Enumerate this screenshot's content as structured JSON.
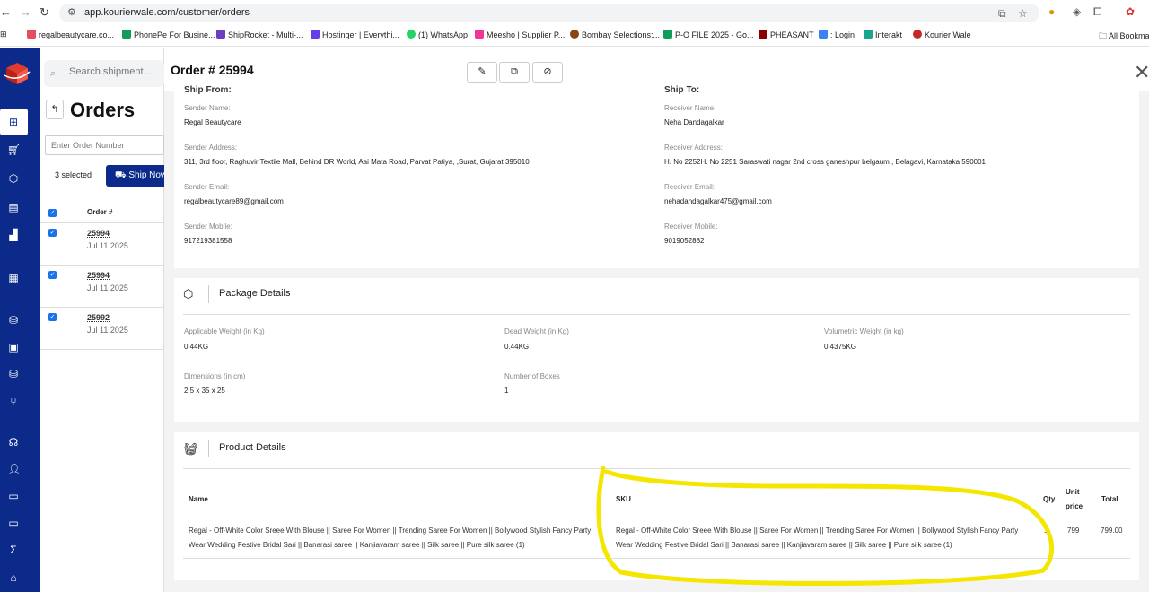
{
  "browser": {
    "url": "app.kourierwale.com/customer/orders",
    "bookmarks": [
      {
        "label": "regalbeautycare.co...",
        "color": "#e84a5f"
      },
      {
        "label": "PhonePe For Busine...",
        "color": "#5f259f"
      },
      {
        "label": "ShipRocket - Multi-...",
        "color": "#6c3ec1"
      },
      {
        "label": "Hostinger | Everythi...",
        "color": "#673de6"
      },
      {
        "label": "(1) WhatsApp",
        "color": "#25d366"
      },
      {
        "label": "Meesho | Supplier P...",
        "color": "#f43397"
      },
      {
        "label": "Bombay Selections:...",
        "color": "#8b4513"
      },
      {
        "label": "P-O FILE 2025 - Go...",
        "color": "#0f9d58"
      },
      {
        "label": "PHEASANT",
        "color": "#8b0000"
      },
      {
        "label": ": Login",
        "color": "#3b82f6"
      },
      {
        "label": "Interakt",
        "color": "#1aa58f"
      },
      {
        "label": "Kourier Wale",
        "color": "#c62828"
      }
    ],
    "all_bookmarks": "All Bookma"
  },
  "orders_panel": {
    "search_placeholder": "Search shipment...",
    "title": "Orders",
    "order_number_placeholder": "Enter Order Number",
    "selected_text": "3 selected",
    "ship_now_label": "Ship Now",
    "column_order": "Order #",
    "orders": [
      {
        "number": "25994",
        "date": "Jul 11 2025"
      },
      {
        "number": "25994",
        "date": "Jul 11 2025"
      },
      {
        "number": "25992",
        "date": "Jul 11 2025"
      }
    ]
  },
  "drawer": {
    "title": "Order # 25994",
    "ship_from_heading": "Ship From:",
    "ship_to_heading": "Ship To:",
    "sender": {
      "name_label": "Sender Name:",
      "name": "Regal Beautycare",
      "address_label": "Sender Address:",
      "address": "311, 3rd floor, Raghuvir Textile Mall, Behind DR World, Aai Mata Road, Parvat Patiya, ,Surat, Gujarat 395010",
      "email_label": "Sender Email:",
      "email": "regalbeautycare89@gmail.com",
      "mobile_label": "Sender Mobile:",
      "mobile": "917219381558"
    },
    "receiver": {
      "name_label": "Receiver Name:",
      "name": "Neha Dandagalkar",
      "address_label": "Receiver Address:",
      "address": "H. No 2252H. No 2251 Saraswati nagar 2nd cross ganeshpur belgaum , Belagavi, Karnataka 590001",
      "email_label": "Receiver Email:",
      "email": "nehadandagalkar475@gmail.com",
      "mobile_label": "Receiver Mobile:",
      "mobile": "9019052882"
    },
    "package": {
      "title": "Package Details",
      "applicable_weight_label": "Applicable Weight (in Kg)",
      "applicable_weight": "0.44KG",
      "dead_weight_label": "Dead Weight (in Kg)",
      "dead_weight": "0.44KG",
      "volumetric_weight_label": "Volumetric Weight (in kg)",
      "volumetric_weight": "0.4375KG",
      "dimensions_label": "Dimensions (in cm)",
      "dimensions": "2.5 x 35 x 25",
      "boxes_label": "Number of Boxes",
      "boxes": "1"
    },
    "products": {
      "title": "Product Details",
      "headers": {
        "name": "Name",
        "sku": "SKU",
        "qty": "Qty",
        "unit_price_1": "Unit",
        "unit_price_2": "price",
        "total": "Total"
      },
      "rows": [
        {
          "name_line1": "Regal - Off-White Color Sreee With Blouse || Saree For Women || Trending Saree For Women || Bollywood Stylish Fancy Party",
          "name_line2": "Wear Wedding Festive Bridal Sari || Banarasi saree || Kanjiavaram saree || Silk saree || Pure silk saree (1)",
          "sku_line1": "Regal - Off-White Color Sreee With Blouse || Saree For Women || Trending Saree For Women || Bollywood Stylish Fancy Party",
          "sku_line2": "Wear Wedding Festive Bridal Sari || Banarasi saree || Kanjiavaram saree || Silk saree || Pure silk saree (1)",
          "qty": "1",
          "unit_price": "799",
          "total": "799.00"
        }
      ]
    }
  },
  "colors": {
    "sidebar": "#0b2a8a",
    "highlight": "#f5e600"
  }
}
